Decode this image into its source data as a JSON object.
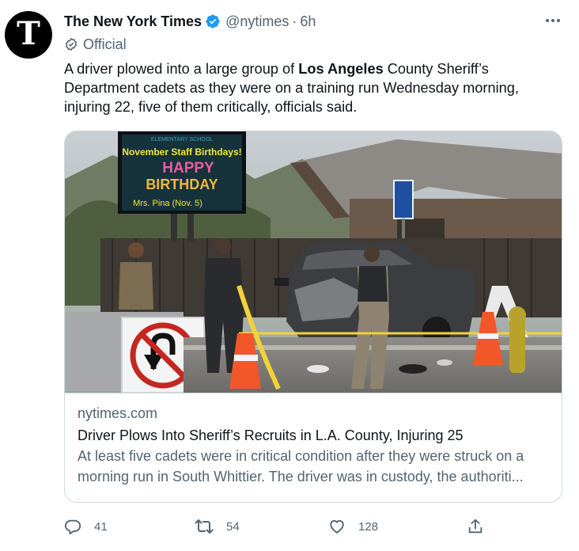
{
  "author": {
    "name": "The New York Times",
    "handle": "@nytimes",
    "separator": "·",
    "time": "6h",
    "label": "Official",
    "avatar_glyph": "T"
  },
  "tweet": {
    "text_before": "A driver plowed into a large group of ",
    "text_bold": "Los Angeles",
    "text_after": " County Sheriff’s Department cadets as they were on a training run Wednesday morning, injuring 22, five of them critically, officials said."
  },
  "card": {
    "domain": "nytimes.com",
    "title": "Driver Plows Into Sheriff’s Recruits in L.A. County, Injuring 25",
    "description_line1": "At least five cadets were in critical condition after they were struck on a",
    "description_line2": "morning run in South Whittier. The driver was in custody, the authoriti...",
    "photo_sign": {
      "school": "ELEMENTARY SCHOOL",
      "line1": "November Staff Birthdays!",
      "line2": "HAPPY",
      "line3": "BIRTHDAY",
      "line4": "Mrs. Pina (Nov. 5)"
    }
  },
  "actions": {
    "reply_count": "41",
    "retweet_count": "54",
    "like_count": "128"
  },
  "colors": {
    "verified_blue": "#1d9bf0",
    "text_primary": "#0f1419",
    "text_secondary": "#536471",
    "border": "#cfd9de"
  },
  "icons": [
    "verified-badge-icon",
    "more-icon",
    "official-badge-icon",
    "reply-icon",
    "retweet-icon",
    "like-icon",
    "share-icon"
  ]
}
